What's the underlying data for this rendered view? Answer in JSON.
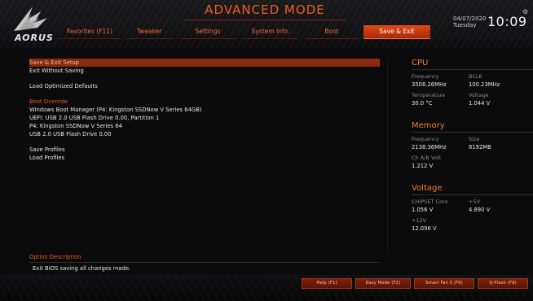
{
  "header": {
    "title": "ADVANCED MODE",
    "brand": "AORUS",
    "date": "04/07/2020",
    "day": "Tuesday",
    "time": "10:09",
    "tabs": [
      {
        "label": "Favorites (F11)",
        "active": false
      },
      {
        "label": "Tweaker",
        "active": false
      },
      {
        "label": "Settings",
        "active": false
      },
      {
        "label": "System Info.",
        "active": false
      },
      {
        "label": "Boot",
        "active": false
      },
      {
        "label": "Save & Exit",
        "active": true
      }
    ]
  },
  "menu": {
    "save_exit_setup": "Save & Exit Setup",
    "exit_without_saving": "Exit Without Saving",
    "load_optimized_defaults": "Load Optimized Defaults",
    "boot_override_header": "Boot Override",
    "boot_items": [
      "Windows Boot Manager (P4: Kingston SSDNow V Series 64GB)",
      "UEFI: USB 2.0 USB Flash Drive 0.00, Partition 1",
      "P4: Kingston SSDNow V Series 64",
      "USB 2.0 USB Flash Drive 0.00"
    ],
    "save_profiles": "Save Profiles",
    "load_profiles": "Load Profiles"
  },
  "option_description": {
    "title": "Option Description",
    "text": "Exit BIOS saving all changes made."
  },
  "cpu": {
    "title": "CPU",
    "frequency_label": "Frequency",
    "frequency_value": "3508.26MHz",
    "bclk_label": "BCLK",
    "bclk_value": "100.23MHz",
    "temperature_label": "Temperature",
    "temperature_value": "30.0 °C",
    "voltage_label": "Voltage",
    "voltage_value": "1.044 V"
  },
  "memory": {
    "title": "Memory",
    "frequency_label": "Frequency",
    "frequency_value": "2138.36MHz",
    "size_label": "Size",
    "size_value": "8192MB",
    "chab_label": "Ch A/B Volt",
    "chab_value": "1.212 V"
  },
  "voltage": {
    "title": "Voltage",
    "chipset_label": "CHIPSET Core",
    "chipset_value": "1.056 V",
    "p5v_label": "+5V",
    "p5v_value": "4.890 V",
    "p12v_label": "+12V",
    "p12v_value": "12.096 V"
  },
  "footer": {
    "help": "Help (F1)",
    "easy_mode": "Easy Mode (F2)",
    "smart_fan": "Smart Fan 5 (F6)",
    "qflash": "Q-Flash (F8)"
  },
  "colors": {
    "accent": "#f05a2a",
    "selected_row": "#8a2a0e",
    "background": "#0b0b0c"
  },
  "icons": {
    "logo": "aorus-eagle-icon",
    "settings": "gear-icon"
  }
}
